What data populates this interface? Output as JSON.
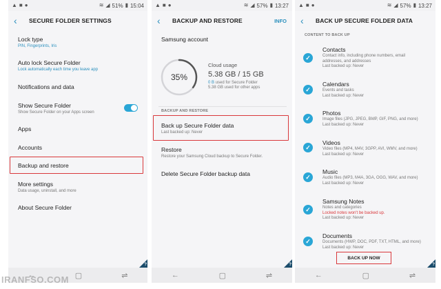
{
  "screen1": {
    "status": {
      "percent": "51%",
      "time": "15:04"
    },
    "title": "SECURE FOLDER SETTINGS",
    "items": [
      {
        "title": "Lock type",
        "sub": "PIN, Fingerprints, Iris"
      },
      {
        "title": "Auto lock Secure Folder",
        "sub": "Lock automatically each time you leave app"
      },
      {
        "title": "Notifications and data",
        "sub": ""
      },
      {
        "title": "Show Secure Folder",
        "sub": "Show Secure Folder on your Apps screen"
      },
      {
        "title": "Apps",
        "sub": ""
      },
      {
        "title": "Accounts",
        "sub": ""
      },
      {
        "title": "Backup and restore",
        "sub": ""
      },
      {
        "title": "More settings",
        "sub": "Data usage, uninstall, and more"
      },
      {
        "title": "About Secure Folder",
        "sub": ""
      }
    ],
    "show_toggle_on": true
  },
  "screen2": {
    "status": {
      "percent": "57%",
      "time": "13:27"
    },
    "title": "BACKUP AND RESTORE",
    "action": "INFO",
    "account_label": "Samsung account",
    "cloud": {
      "percent_label": "35%",
      "percent_value": 35,
      "heading": "Cloud usage",
      "usage": "5.38 GB / 15 GB",
      "used_secure_value": "0 B",
      "used_secure_text": "used for Secure Folder",
      "used_other": "5.38 GB used for other apps"
    },
    "section": "BACKUP AND RESTORE",
    "items": [
      {
        "title": "Back up Secure Folder data",
        "sub": "Last backed up: Never"
      },
      {
        "title": "Restore",
        "sub": "Restore your Samsung Cloud backup to Secure Folder."
      },
      {
        "title": "Delete Secure Folder backup data",
        "sub": ""
      }
    ]
  },
  "screen3": {
    "status": {
      "percent": "57%",
      "time": "13:27"
    },
    "title": "BACK UP SECURE FOLDER DATA",
    "section": "CONTENT TO BACK UP",
    "items": [
      {
        "title": "Contacts",
        "desc1": "Contact info, including phone numbers, email",
        "desc2": "addresses, and addresses",
        "last": "Last backed up: Never"
      },
      {
        "title": "Calendars",
        "desc1": "Events and tasks",
        "desc2": "",
        "last": "Last backed up: Never"
      },
      {
        "title": "Photos",
        "desc1": "Image files (JPG, JPEG, BMP, GIF, PNG, and more)",
        "desc2": "",
        "last": "Last backed up: Never"
      },
      {
        "title": "Videos",
        "desc1": "Video files (MP4, M4V, 3GPP, AVI, WMV, and more)",
        "desc2": "",
        "last": "Last backed up: Never"
      },
      {
        "title": "Music",
        "desc1": "Audio files (MP3, M4A, 3GA, OGG, WAV, and more)",
        "desc2": "",
        "last": "Last backed up: Never"
      },
      {
        "title": "Samsung Notes",
        "desc1": "Notes and categories",
        "desc2": "",
        "warn": "Locked notes won't be backed up.",
        "last": "Last backed up: Never"
      },
      {
        "title": "Documents",
        "desc1": "Documents (HWP, DOC, PDF, TXT, HTML, and more)",
        "desc2": "",
        "last": "Last backed up: Never"
      }
    ],
    "button": "BACK UP NOW"
  },
  "watermark": "IRANFSO.COM",
  "colors": {
    "accent": "#2a8fbd",
    "toggle": "#2aa6d6",
    "highlight": "#d9373a"
  }
}
